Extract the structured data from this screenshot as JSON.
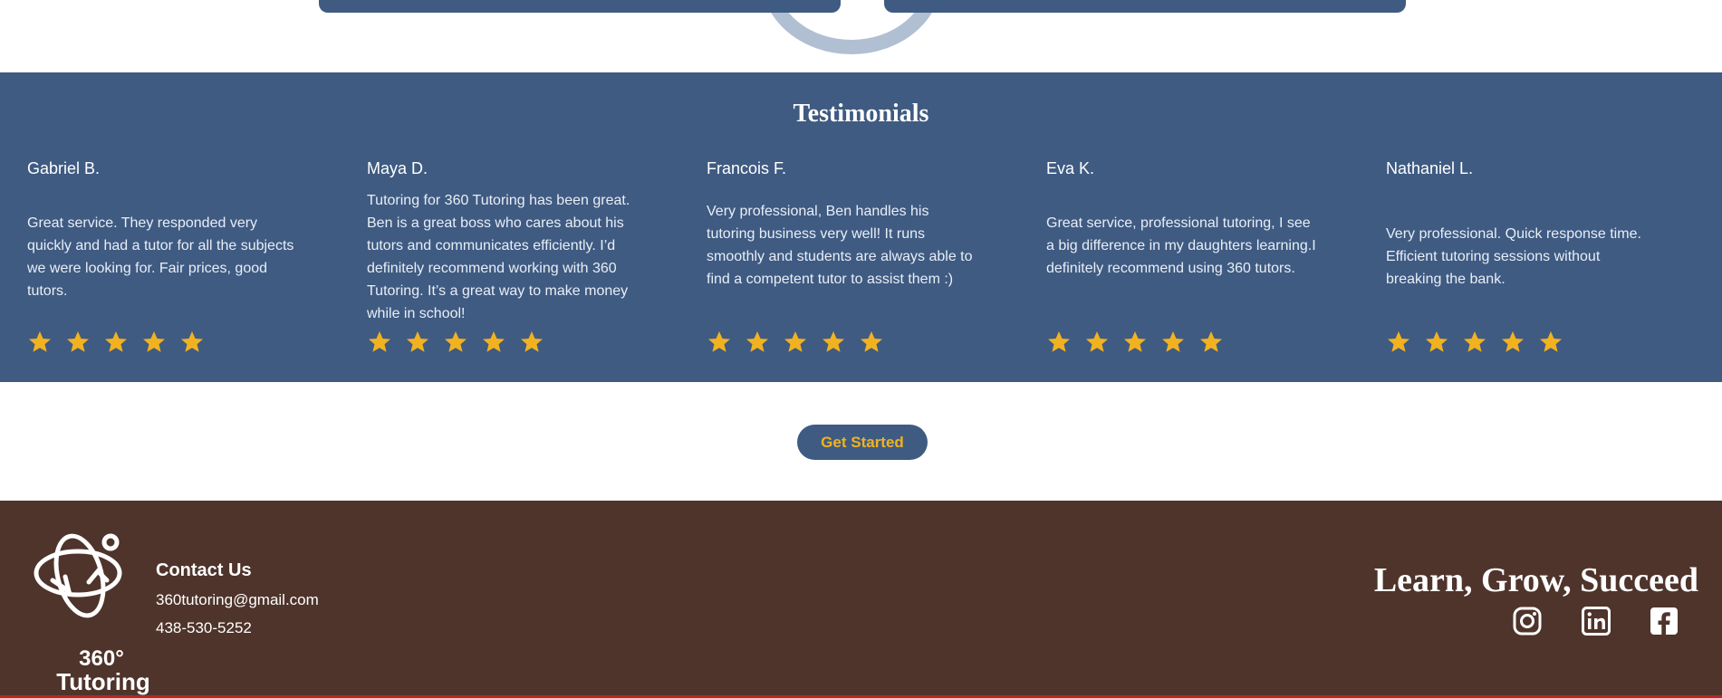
{
  "colors": {
    "brand_blue": "#3f5b82",
    "star_gold": "#f2b21f",
    "footer_brown": "#4f342b",
    "white": "#ffffff"
  },
  "testimonials": {
    "title": "Testimonials",
    "items": [
      {
        "name": "Gabriel B.",
        "text": "Great service. They responded very quickly and had a tutor for all the subjects we were looking for. Fair prices, good tutors.",
        "stars": 5
      },
      {
        "name": "Maya D.",
        "text": "Tutoring for 360 Tutoring has been great. Ben is a great boss who cares about his tutors and communicates efficiently. I’d definitely recommend working with 360 Tutoring. It’s a great way to make money while in school!",
        "stars": 5
      },
      {
        "name": "Francois F.",
        "text": "Very professional, Ben handles his tutoring business very well! It runs smoothly and students are always able to find a competent tutor to assist them :)",
        "stars": 5
      },
      {
        "name": "Eva K.",
        "text": "Great service, professional tutoring, I see a big difference in my daughters learning.I definitely recommend using 360 tutors.",
        "stars": 5
      },
      {
        "name": "Nathaniel L.",
        "text": "Very professional. Quick response time. Efficient tutoring sessions without breaking the bank.",
        "stars": 5
      }
    ]
  },
  "cta": {
    "label": "Get Started"
  },
  "footer": {
    "logo_line1": "360°",
    "logo_line2": "Tutoring",
    "contact_title": "Contact Us",
    "email": "360tutoring@gmail.com",
    "phone": "438-530-5252",
    "tagline": "Learn, Grow, Succeed",
    "social": [
      "instagram-icon",
      "linkedin-icon",
      "facebook-icon"
    ]
  }
}
